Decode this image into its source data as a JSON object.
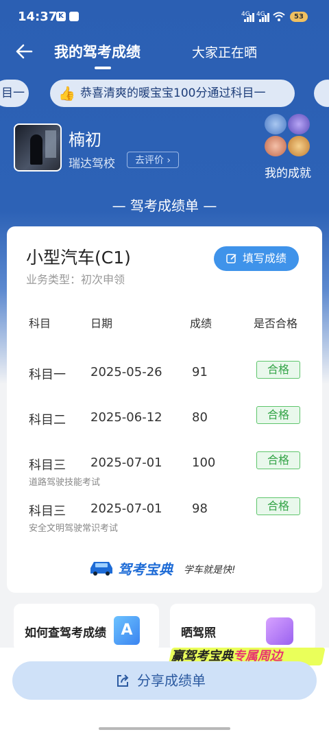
{
  "status": {
    "time": "14:37",
    "net1": "4G",
    "net2": "4G",
    "battery": "53"
  },
  "nav": {
    "tab_active": "我的驾考成绩",
    "tab_other": "大家正在晒"
  },
  "ticker": {
    "left_fragment": "目一",
    "main": "恭喜清爽的暖宝宝100分通过科目一"
  },
  "profile": {
    "name": "楠初",
    "school": "瑞达驾校",
    "rate_label": "去评价",
    "achievements_label": "我的成就"
  },
  "section_title": "— 驾考成绩单 —",
  "card": {
    "car_type": "小型汽车(C1)",
    "business_type": "业务类型：初次申领",
    "fill_button": "填写成绩",
    "headers": {
      "subject": "科目",
      "date": "日期",
      "score": "成绩",
      "passed": "是否合格"
    },
    "rows": [
      {
        "subject": "科目一",
        "date": "2025-05-26",
        "score": "91",
        "status": "合格",
        "note": ""
      },
      {
        "subject": "科目二",
        "date": "2025-06-12",
        "score": "80",
        "status": "合格",
        "note": ""
      },
      {
        "subject": "科目三",
        "date": "2025-07-01",
        "score": "100",
        "status": "合格",
        "note": "道路驾驶技能考试"
      },
      {
        "subject": "科目三",
        "date": "2025-07-01",
        "score": "98",
        "status": "合格",
        "note": "安全文明驾驶常识考试"
      }
    ],
    "brand_name": "驾考宝典",
    "brand_slogan": "学车就是快!"
  },
  "mini_cards": {
    "left_title": "如何查驾考成绩",
    "left_icon_letter": "A",
    "right_title": "晒驾照"
  },
  "promo": {
    "part1": "赢驾考宝典",
    "part2": "专属周边"
  },
  "share_button": "分享成绩单",
  "colors": {
    "primary_blue": "#2b5fb3",
    "button_blue": "#3f93ea",
    "pass_green": "#34a447"
  }
}
